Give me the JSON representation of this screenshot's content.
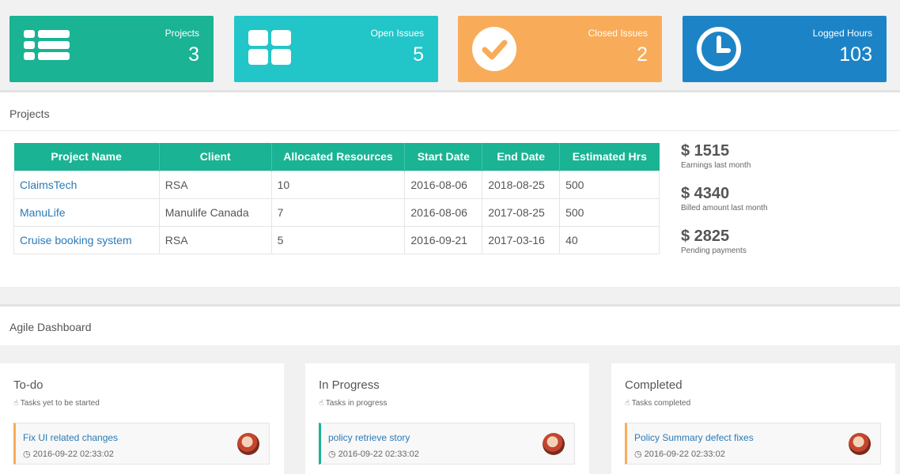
{
  "stats": [
    {
      "label": "Projects",
      "value": "3",
      "color": "#1ab394",
      "icon": "list-icon"
    },
    {
      "label": "Open Issues",
      "value": "5",
      "color": "#23c6c8",
      "icon": "grid-icon"
    },
    {
      "label": "Closed Issues",
      "value": "2",
      "color": "#f8ac59",
      "icon": "check-circle-icon"
    },
    {
      "label": "Logged Hours",
      "value": "103",
      "color": "#1c84c6",
      "icon": "clock-icon"
    }
  ],
  "projects": {
    "title": "Projects",
    "headers": [
      "Project Name",
      "Client",
      "Allocated Resources",
      "Start Date",
      "End Date",
      "Estimated Hrs"
    ],
    "rows": [
      [
        "ClaimsTech",
        "RSA",
        "10",
        "2016-08-06",
        "2018-08-25",
        "500"
      ],
      [
        "ManuLife",
        "Manulife Canada",
        "7",
        "2016-08-06",
        "2017-08-25",
        "500"
      ],
      [
        "Cruise booking system",
        "RSA",
        "5",
        "2016-09-21",
        "2017-03-16",
        "40"
      ]
    ]
  },
  "earnings": [
    {
      "amount": "$ 1515",
      "label": "Earnings last month"
    },
    {
      "amount": "$ 4340",
      "label": "Billed amount last month"
    },
    {
      "amount": "$ 2825",
      "label": "Pending payments"
    }
  ],
  "agile": {
    "title": "Agile Dashboard",
    "columns": [
      {
        "title": "To-do",
        "subtitle": "Tasks yet to be started",
        "task": "Fix UI related changes",
        "date": "2016-09-22 02:33:02"
      },
      {
        "title": "In Progress",
        "subtitle": "Tasks in progress",
        "task": "policy retrieve story",
        "date": "2016-09-22 02:33:02"
      },
      {
        "title": "Completed",
        "subtitle": "Tasks completed",
        "task": "Policy Summary defect fixes",
        "date": "2016-09-22 02:33:02"
      }
    ]
  }
}
